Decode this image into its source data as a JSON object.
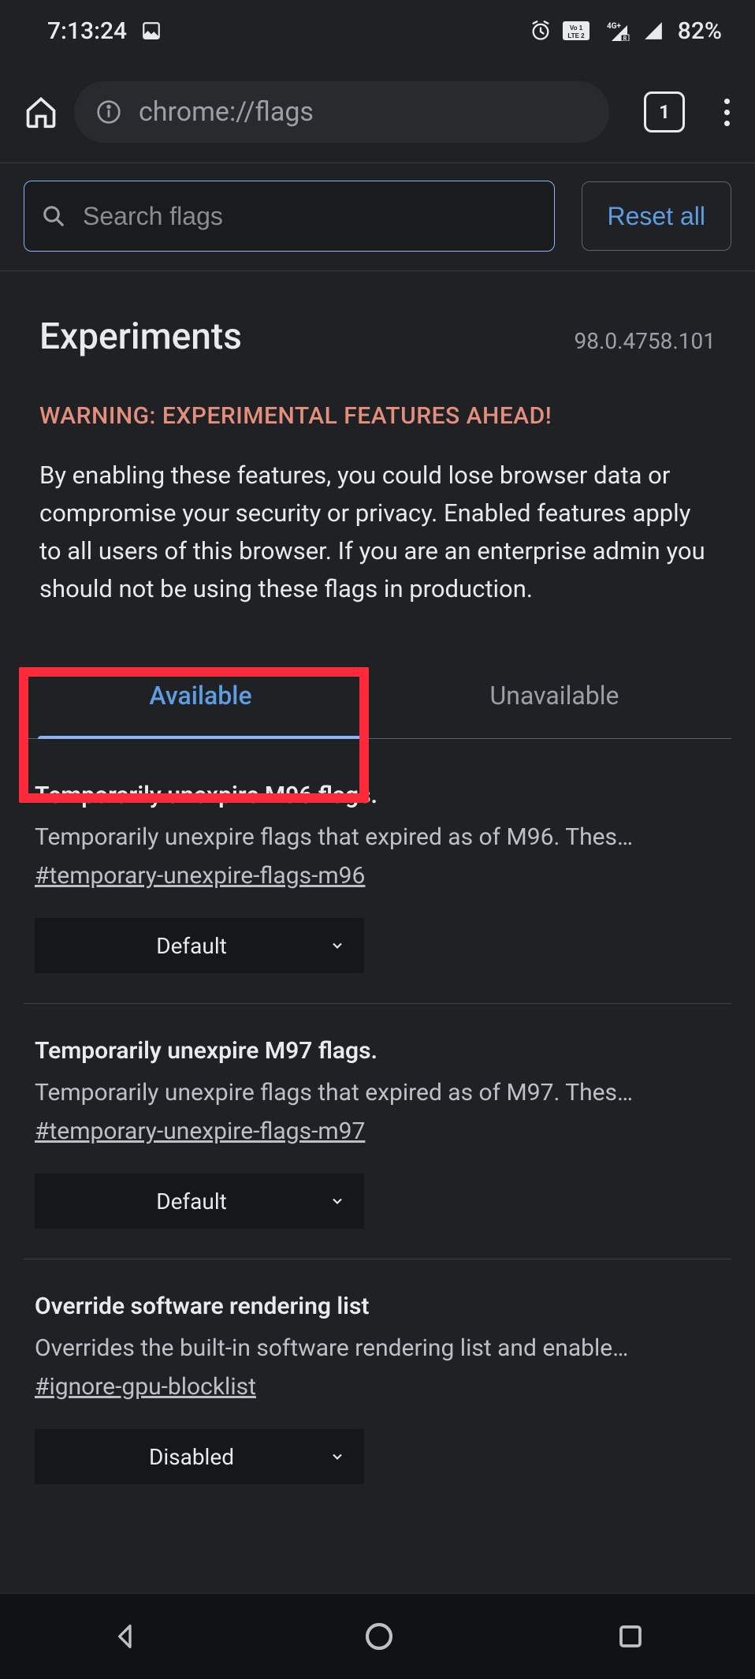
{
  "status": {
    "time": "7:13:24",
    "battery": "82%"
  },
  "browser": {
    "url": "chrome://flags",
    "tab_count": "1"
  },
  "search": {
    "placeholder": "Search flags",
    "reset_label": "Reset all"
  },
  "header": {
    "title": "Experiments",
    "version": "98.0.4758.101",
    "warning_title": "WARNING: EXPERIMENTAL FEATURES AHEAD!",
    "warning_body": "By enabling these features, you could lose browser data or compromise your security or privacy. Enabled features apply to all users of this browser. If you are an enterprise admin you should not be using these flags in production."
  },
  "tabs": {
    "available": "Available",
    "unavailable": "Unavailable"
  },
  "flags": [
    {
      "title": "Temporarily unexpire M96 flags.",
      "description": "Temporarily unexpire flags that expired as of M96. Thes…",
      "anchor": "#temporary-unexpire-flags-m96",
      "value": "Default"
    },
    {
      "title": "Temporarily unexpire M97 flags.",
      "description": "Temporarily unexpire flags that expired as of M97. Thes…",
      "anchor": "#temporary-unexpire-flags-m97",
      "value": "Default"
    },
    {
      "title": "Override software rendering list",
      "description": "Overrides the built-in software rendering list and enable…",
      "anchor": "#ignore-gpu-blocklist",
      "value": "Disabled"
    }
  ]
}
